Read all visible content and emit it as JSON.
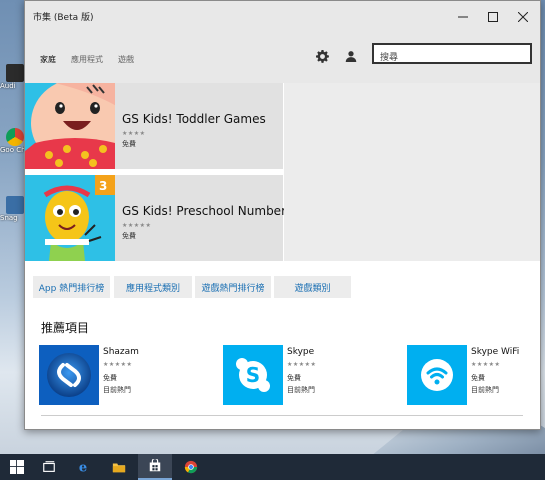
{
  "window": {
    "title": "市集 (Beta 版)"
  },
  "nav": {
    "tabs": [
      "家庭",
      "應用程式",
      "遊戲"
    ],
    "active_tab": "家庭",
    "search_placeholder": "搜尋"
  },
  "featured": [
    {
      "title": "GS Kids! Toddler Games",
      "stars": "★★★★",
      "price": "免費"
    },
    {
      "title": "GS Kids! Preschool Numbers",
      "stars": "★★★★★",
      "price": "免費"
    }
  ],
  "categories": [
    "App 熱門排行榜",
    "應用程式類別",
    "遊戲熱門排行榜",
    "遊戲類別"
  ],
  "recommended": {
    "title": "推薦項目",
    "apps": [
      {
        "name": "Shazam",
        "stars": "★★★★★",
        "rating": 4,
        "price": "免費",
        "tag": "目前熱門",
        "icon": "shazam-logo"
      },
      {
        "name": "Skype",
        "stars": "★★★★★",
        "rating": 3,
        "price": "免費",
        "tag": "目前熱門",
        "icon": "skype-logo"
      },
      {
        "name": "Skype WiFi",
        "stars": "★★★★★",
        "rating": 3,
        "price": "免費",
        "tag": "目前熱門",
        "icon": "wifi-logo"
      }
    ]
  },
  "desktop": {
    "icons": [
      "Audi",
      "Goo Chro",
      "Snag"
    ]
  },
  "taskbar": {
    "items": [
      "windows-start-icon",
      "task-view-icon",
      "edge-icon",
      "file-explorer-icon",
      "store-icon",
      "chrome-icon"
    ],
    "active": "store-icon"
  },
  "colors": {
    "accent": "#1a6fb3",
    "shazam": "#0a6bd6",
    "skype": "#00aff0"
  }
}
